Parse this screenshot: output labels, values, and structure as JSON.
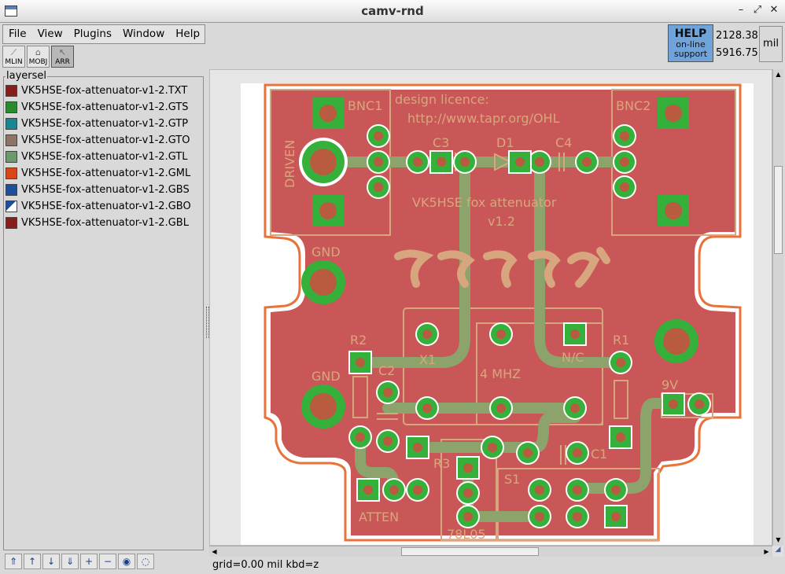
{
  "window": {
    "title": "camv-rnd"
  },
  "window_controls": [
    "–",
    "⤢",
    "✕"
  ],
  "menu": [
    "File",
    "View",
    "Plugins",
    "Window",
    "Help"
  ],
  "toolbar": [
    {
      "label": "MLIN",
      "icon": "measure-line-icon",
      "active": false
    },
    {
      "label": "MOBJ",
      "icon": "move-object-icon",
      "active": false
    },
    {
      "label": "ARR",
      "icon": "arrow-pointer-icon",
      "active": true
    }
  ],
  "help": {
    "title": "HELP",
    "line1": "on-line",
    "line2": "support"
  },
  "coords": {
    "x": "2128.38",
    "y": "5916.75",
    "unit": "mil"
  },
  "layersel": {
    "label": "layersel",
    "layers": [
      {
        "name": "VK5HSE-fox-attenuator-v1-2.TXT",
        "color": "#8b1c1c"
      },
      {
        "name": "VK5HSE-fox-attenuator-v1-2.GTS",
        "color": "#2b8a2b"
      },
      {
        "name": "VK5HSE-fox-attenuator-v1-2.GTP",
        "color": "#1c8592"
      },
      {
        "name": "VK5HSE-fox-attenuator-v1-2.GTO",
        "color": "#8c7566"
      },
      {
        "name": "VK5HSE-fox-attenuator-v1-2.GTL",
        "color": "#6b9a6b"
      },
      {
        "name": "VK5HSE-fox-attenuator-v1-2.GML",
        "color": "#d8461a"
      },
      {
        "name": "VK5HSE-fox-attenuator-v1-2.GBS",
        "color": "#1f4f99"
      },
      {
        "name": "VK5HSE-fox-attenuator-v1-2.GBO",
        "color": "#ffffff"
      },
      {
        "name": "VK5HSE-fox-attenuator-v1-2.GBL",
        "color": "#8b1c1c"
      }
    ]
  },
  "bottom_tools": [
    {
      "icon": "move-to-top-icon",
      "glyph": "⇑"
    },
    {
      "icon": "move-up-icon",
      "glyph": "↑"
    },
    {
      "icon": "move-down-icon",
      "glyph": "↓"
    },
    {
      "icon": "move-to-bottom-icon",
      "glyph": "⇓"
    },
    {
      "icon": "add-layer-icon",
      "glyph": "+"
    },
    {
      "icon": "remove-layer-icon",
      "glyph": "−"
    },
    {
      "icon": "show-layer-icon",
      "glyph": "◉"
    },
    {
      "icon": "hide-layer-icon",
      "glyph": "◌"
    }
  ],
  "pcb_text": {
    "bnc1": "BNC1",
    "bnc2": "BNC2",
    "driven": "DRIVEN",
    "licence1": "design licence:",
    "licence2": "http://www.tapr.org/OHL",
    "c3": "C3",
    "d1": "D1",
    "c4": "C4",
    "board1": "VK5HSE  fox attenuator",
    "board2": "v1.2",
    "gnd1": "GND",
    "gnd2": "GND",
    "r2": "R2",
    "x1": "X1",
    "mhz": "4 MHZ",
    "nc": "N/C",
    "r1": "R1",
    "c2": "C2",
    "v9": "9V",
    "c1": "C1",
    "r3": "R3",
    "s1": "S1",
    "atten": "ATTEN",
    "part": "78L05"
  },
  "status": {
    "text": "grid=0.00 mil  kbd=z"
  },
  "colors": {
    "board": "#c95757",
    "outline": "#e8733a",
    "pad": "#35b13b",
    "trace": "#8da36c",
    "silk": "#d8a67e",
    "pad_hole": "#b85b3e"
  }
}
